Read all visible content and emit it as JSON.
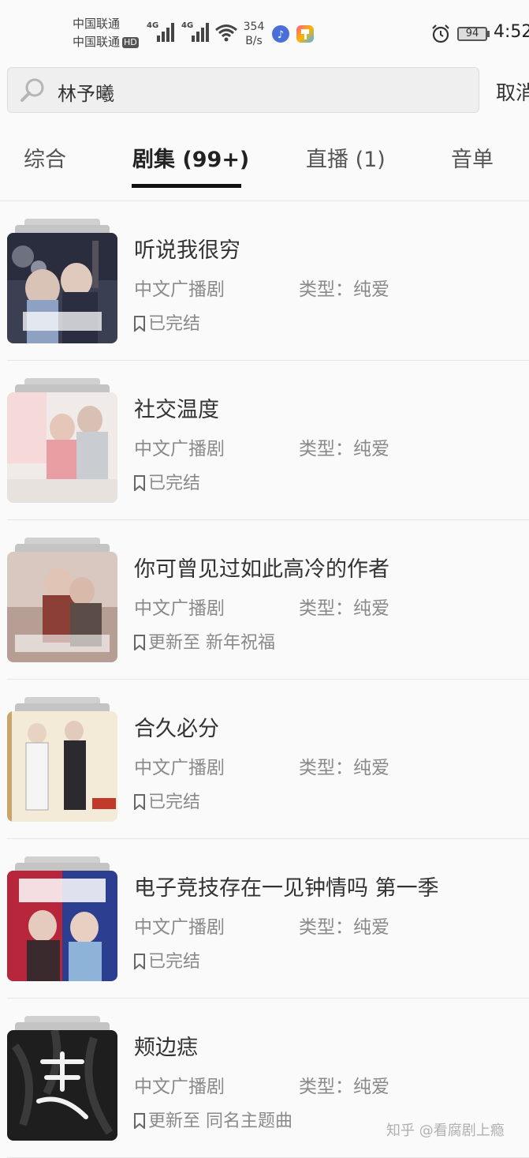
{
  "status_bar": {
    "carrier_1": "中国联通",
    "carrier_2": "中国联通",
    "hd_badge": "HD",
    "network_1": "4G",
    "network_2": "4G",
    "speed_value": "354",
    "speed_unit": "B/s",
    "battery": "94",
    "time": "4:52"
  },
  "search": {
    "query": "林予曦",
    "cancel_label": "取消"
  },
  "tabs": [
    {
      "label": "综合"
    },
    {
      "label": "剧集 (99+)"
    },
    {
      "label": "直播 (1)"
    },
    {
      "label": "音单"
    }
  ],
  "results": [
    {
      "title": "听说我很穷",
      "category": "中文广播剧",
      "genre": "类型：纯爱",
      "status": "已完结"
    },
    {
      "title": "社交温度",
      "category": "中文广播剧",
      "genre": "类型：纯爱",
      "status": "已完结"
    },
    {
      "title": "你可曾见过如此高冷的作者",
      "category": "中文广播剧",
      "genre": "类型：纯爱",
      "status": "更新至 新年祝福"
    },
    {
      "title": "合久必分",
      "category": "中文广播剧",
      "genre": "类型：纯爱",
      "status": "已完结"
    },
    {
      "title": "电子竞技存在一见钟情吗 第一季",
      "category": "中文广播剧",
      "genre": "类型：纯爱",
      "status": "已完结"
    },
    {
      "title": "颊边痣",
      "category": "中文广播剧",
      "genre": "类型：纯爱",
      "status": "更新至 同名主题曲"
    }
  ],
  "watermark": "知乎 @看腐剧上瘾",
  "colors": {
    "background": "#fafafa",
    "active_tab_underline": "#111111",
    "meta_text": "#8a8a8a"
  }
}
